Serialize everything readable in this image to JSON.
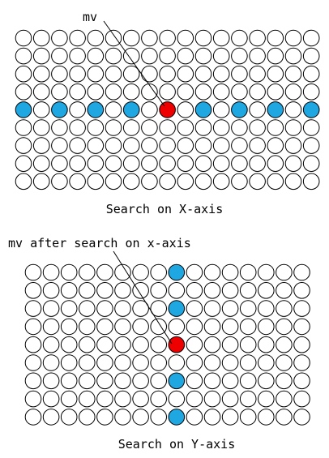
{
  "panels": [
    {
      "title": "Search on X-axis",
      "annotation": "mv",
      "grid": {
        "rows": 9,
        "cols": 17,
        "highlight_row": 4,
        "blue_cells": [
          [
            4,
            0
          ],
          [
            4,
            2
          ],
          [
            4,
            4
          ],
          [
            4,
            6
          ],
          [
            4,
            10
          ],
          [
            4,
            12
          ],
          [
            4,
            14
          ],
          [
            4,
            16
          ]
        ],
        "red_cells": [
          [
            4,
            8
          ]
        ]
      }
    },
    {
      "title": "Search on Y-axis",
      "annotation": "mv after search on x-axis",
      "grid": {
        "rows": 9,
        "cols": 16,
        "blue_cells": [
          [
            0,
            8
          ],
          [
            2,
            8
          ],
          [
            6,
            8
          ],
          [
            8,
            8
          ]
        ],
        "red_cells": [
          [
            4,
            8
          ]
        ]
      }
    }
  ],
  "colors": {
    "empty": "#ffffff",
    "stroke": "#000000",
    "blue": "#1ea7e1",
    "red": "#ee0000"
  }
}
